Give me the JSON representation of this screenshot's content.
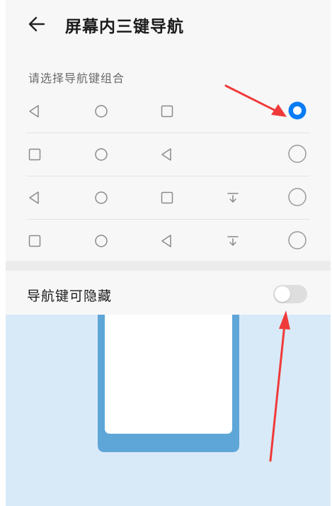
{
  "header": {
    "title": "屏幕内三键导航",
    "back_icon": "back-arrow-icon"
  },
  "section": {
    "label": "请选择导航键组合"
  },
  "options": [
    {
      "keys": [
        "back-triangle-icon",
        "home-circle-icon",
        "recent-square-icon"
      ],
      "selected": true
    },
    {
      "keys": [
        "recent-square-icon",
        "home-circle-icon",
        "back-triangle-icon"
      ],
      "selected": false
    },
    {
      "keys": [
        "back-triangle-icon",
        "home-circle-icon",
        "recent-square-icon",
        "notification-pulldown-icon"
      ],
      "selected": false
    },
    {
      "keys": [
        "recent-square-icon",
        "home-circle-icon",
        "back-triangle-icon",
        "notification-pulldown-icon"
      ],
      "selected": false
    }
  ],
  "toggle": {
    "label": "导航键可隐藏",
    "on": false
  },
  "colors": {
    "accent": "#0a7cf5",
    "annotation_arrow": "#f03a3a",
    "preview_bg": "#d8eaf8",
    "phone_frame": "#5fa6d8"
  }
}
